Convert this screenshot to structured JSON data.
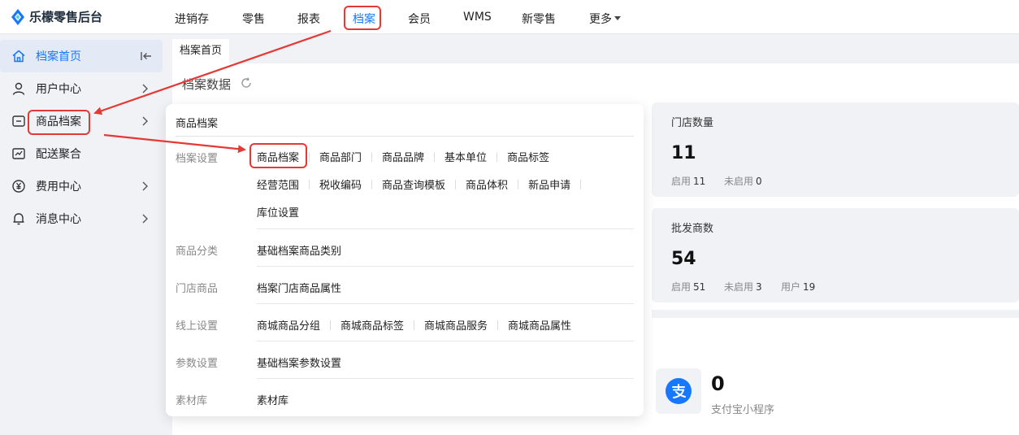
{
  "app": {
    "brand": "乐檬零售后台"
  },
  "nav": {
    "items": [
      "进销存",
      "零售",
      "报表",
      "档案",
      "会员",
      "WMS",
      "新零售",
      "更多"
    ],
    "active": "档案"
  },
  "sidebar": {
    "items": [
      {
        "label": "档案首页",
        "icon": "home-icon"
      },
      {
        "label": "用户中心",
        "icon": "user-icon"
      },
      {
        "label": "商品档案",
        "icon": "goods-icon"
      },
      {
        "label": "配送聚合",
        "icon": "delivery-icon"
      },
      {
        "label": "费用中心",
        "icon": "yen-icon"
      },
      {
        "label": "消息中心",
        "icon": "bell-icon"
      }
    ]
  },
  "tabs": {
    "current": "档案首页"
  },
  "section": {
    "title": "档案数据"
  },
  "stats": {
    "stores": {
      "label": "门店数量",
      "value": "11",
      "enabled_label": "启用",
      "enabled": "11",
      "disabled_label": "未启用",
      "disabled": "0"
    },
    "wholesalers": {
      "label": "批发商数",
      "value": "54",
      "enabled_label": "启用",
      "enabled": "51",
      "disabled_label": "未启用",
      "disabled": "3",
      "users_label": "用户",
      "users": "19"
    }
  },
  "alipay": {
    "count": "0",
    "label": "支付宝小程序"
  },
  "panel": {
    "title": "商品档案",
    "rows": [
      {
        "label": "档案设置",
        "lines": [
          [
            "商品档案",
            "商品部门",
            "商品品牌",
            "基本单位",
            "商品标签"
          ],
          [
            "经营范围",
            "税收编码",
            "商品查询模板",
            "商品体积",
            "新品申请"
          ],
          [
            "库位设置"
          ]
        ]
      },
      {
        "label": "商品分类",
        "lines": [
          [
            "基础档案商品类别"
          ]
        ]
      },
      {
        "label": "门店商品",
        "lines": [
          [
            "档案门店商品属性"
          ]
        ]
      },
      {
        "label": "线上设置",
        "lines": [
          [
            "商城商品分组",
            "商城商品标签",
            "商城商品服务",
            "商城商品属性"
          ]
        ]
      },
      {
        "label": "参数设置",
        "lines": [
          [
            "基础档案参数设置"
          ]
        ]
      },
      {
        "label": "素材库",
        "lines": [
          [
            "素材库"
          ]
        ]
      }
    ]
  },
  "colors": {
    "accent": "#1677ff",
    "highlight": "#e53935",
    "alipay": "#1677ff"
  }
}
